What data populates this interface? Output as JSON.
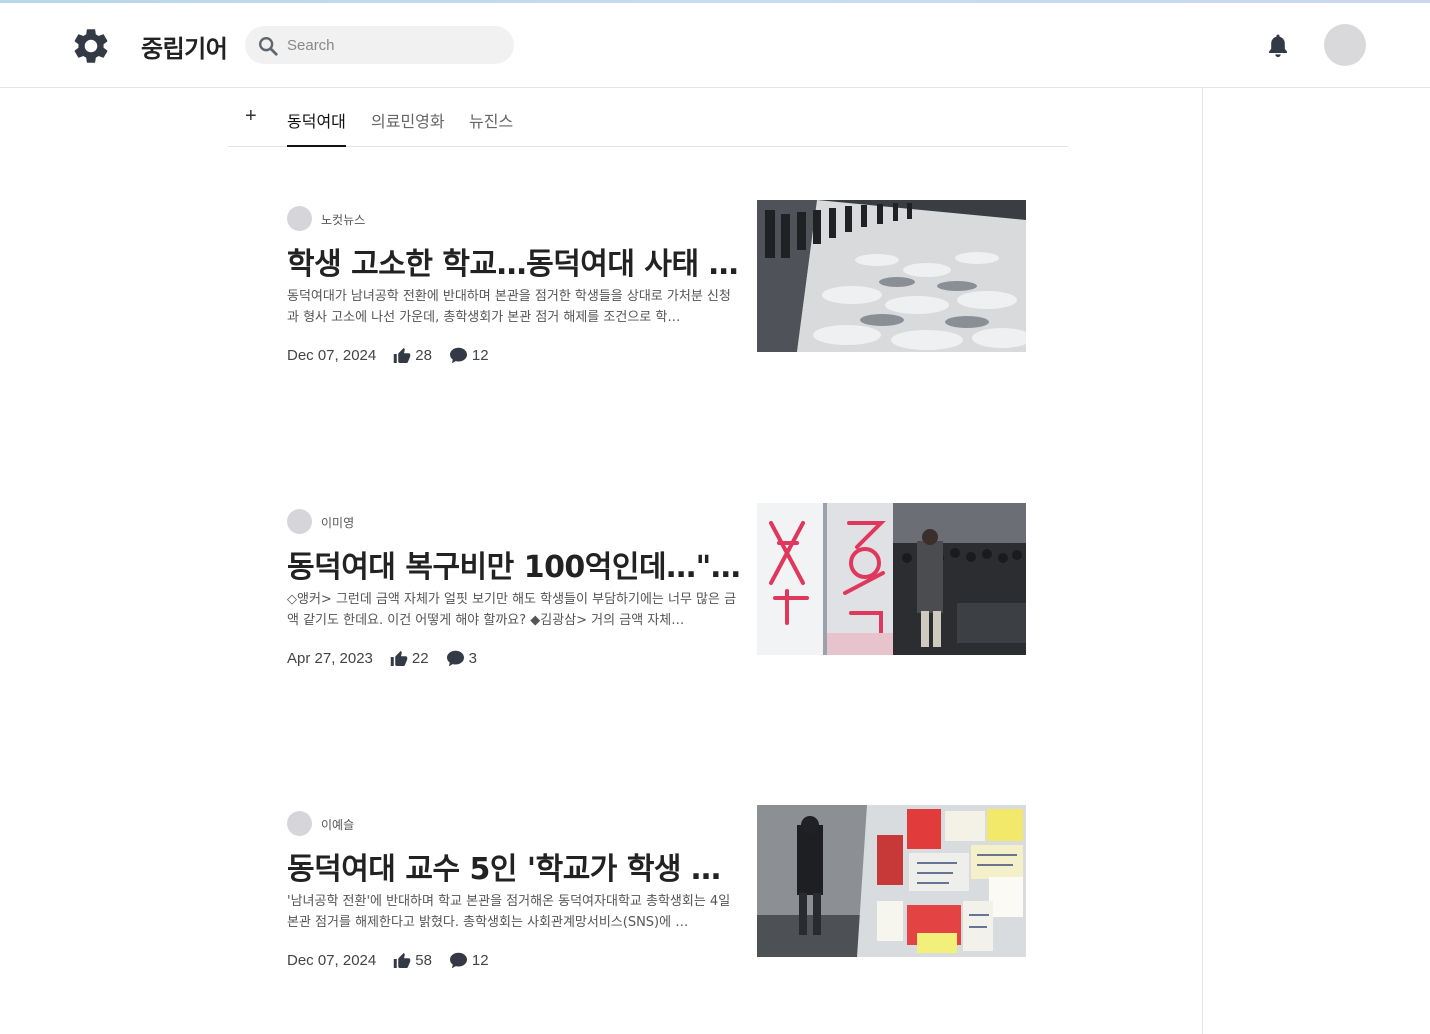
{
  "header": {
    "brand": "중립기어",
    "search_placeholder": "Search"
  },
  "tabs": {
    "add": "+",
    "items": [
      "동덕여대",
      "의료민영화",
      "뉴진스"
    ],
    "active": "동덕여대"
  },
  "articles": [
    {
      "source": "노컷뉴스",
      "title": "학생 고소한 학교…동덕여대 사태 …",
      "summary": "동덕여대가 남녀공학 전환에 반대하며 본관을 점거한 학생들을 상대로 가처분 신청과 형사 고소에 나선 가운데, 총학생회가 본관 점거 해제를 조건으로 학…",
      "date": "Dec 07, 2024",
      "likes": "28",
      "comments": "12"
    },
    {
      "source": "이미영",
      "title": "동덕여대 복구비만 100억인데…\"…",
      "summary": "◇앵커> 그런데 금액 자체가 얼핏 보기만 해도 학생들이 부담하기에는 너무 많은 금액 같기도 한데요. 이건 어떻게 해야 할까요? ◆김광삼> 거의 금액 자체…",
      "date": "Apr 27, 2023",
      "likes": "22",
      "comments": "3"
    },
    {
      "source": "이예슬",
      "title": "동덕여대 교수 5인 '학교가 학생 …",
      "summary": "'남녀공학 전환'에 반대하며 학교 본관을 점거해온 동덕여자대학교 총학생회는 4일 본관 점거를 해제한다고 밝혔다. 총학생회는 사회관계망서비스(SNS)에 …",
      "date": "Dec 07, 2024",
      "likes": "58",
      "comments": "12"
    }
  ],
  "colors": {
    "text": "#222222",
    "muted": "#555555",
    "avatar": "#d9d9dc",
    "icon": "#333a45"
  },
  "icons": [
    "gear-icon",
    "search-icon",
    "bell-icon",
    "thumbs-up-icon",
    "comment-icon"
  ]
}
